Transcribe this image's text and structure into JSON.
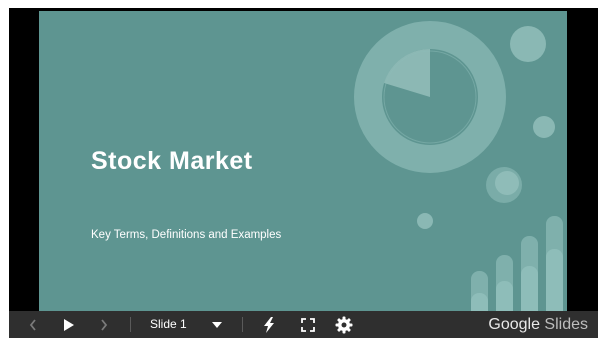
{
  "slide": {
    "title": "Stock Market",
    "subtitle": "Key Terms, Definitions and Examples",
    "background": "#5e9591"
  },
  "toolbar": {
    "prev_icon": "chevron-left-icon",
    "play_icon": "play-icon",
    "next_icon": "chevron-right-icon",
    "slide_selector": "Slide 1",
    "dropdown_icon": "caret-down-icon",
    "laser_icon": "lightning-icon",
    "fullscreen_icon": "fullscreen-icon",
    "settings_icon": "gear-icon",
    "brand_google": "Google",
    "brand_slides": " Slides",
    "background": "#2f2f2f"
  }
}
